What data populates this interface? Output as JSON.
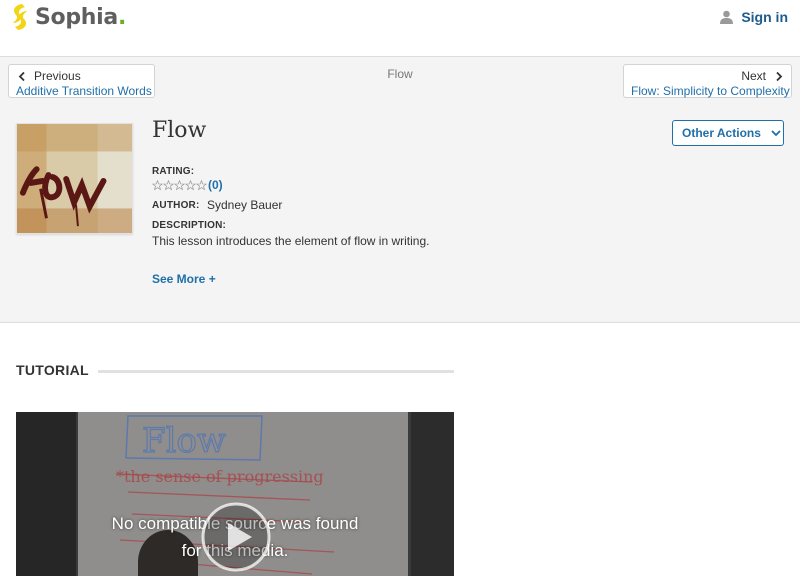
{
  "header": {
    "logo_text": "Sophia",
    "logo_dot": ".",
    "signin_label": "Sign in"
  },
  "nav": {
    "previous_label": "Previous",
    "previous_link": "Additive Transition Words",
    "current": "Flow",
    "next_label": "Next",
    "next_link": "Flow: Simplicity to Complexity"
  },
  "lesson": {
    "title": "Flow",
    "rating_label": "RATING:",
    "rating_count": "(0)",
    "rating_stars": 0,
    "author_label": "AUTHOR:",
    "author": "Sydney Bauer",
    "description_label": "DESCRIPTION:",
    "description": "This lesson introduces the element of flow in writing.",
    "see_more": "See More +",
    "other_actions": "Other Actions"
  },
  "tutorial": {
    "heading": "TUTORIAL",
    "video_message_line1": "No compatible source was found",
    "video_message_line2": "for this media."
  },
  "colors": {
    "brand_green": "#6ab023",
    "link_blue": "#1f6fa9",
    "background_gray": "#f4f4f4"
  },
  "icons": {
    "logo": "sophia-leaf-icon",
    "signin": "user-icon",
    "previous": "chevron-left-icon",
    "next": "chevron-right-icon",
    "dropdown": "chevron-down-icon",
    "star": "star-outline-icon",
    "play": "play-icon"
  }
}
